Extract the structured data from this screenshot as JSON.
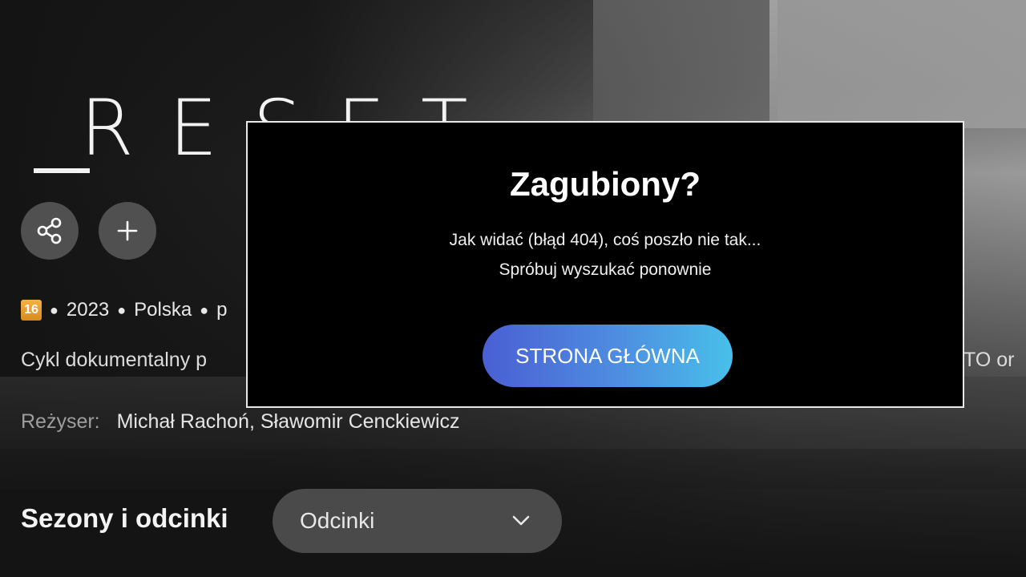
{
  "show": {
    "logo": "_RESET",
    "logo_letters": "RESET",
    "age_rating": "16",
    "meta_year": "2023",
    "meta_country": "Polska",
    "meta_more": "p",
    "description": "Cykl dokumentalny p",
    "description_tail": "TO or",
    "director_label": "Reżyser:",
    "director_value": "Michał Rachoń, Sławomir Cenckiewicz"
  },
  "actions": {
    "share_icon": "share-icon",
    "add_icon": "plus-icon"
  },
  "seasons": {
    "title": "Sezony i odcinki",
    "select_value": "Odcinki"
  },
  "modal": {
    "title": "Zagubiony?",
    "line1": "Jak widać (błąd 404), coś poszło nie tak...",
    "line2": "Spróbuj wyszukać ponownie",
    "button_label": "STRONA GŁÓWNA"
  },
  "colors": {
    "button_gradient_start": "#4a5fd4",
    "button_gradient_end": "#48c0ea",
    "age_badge": "#f4b244"
  }
}
